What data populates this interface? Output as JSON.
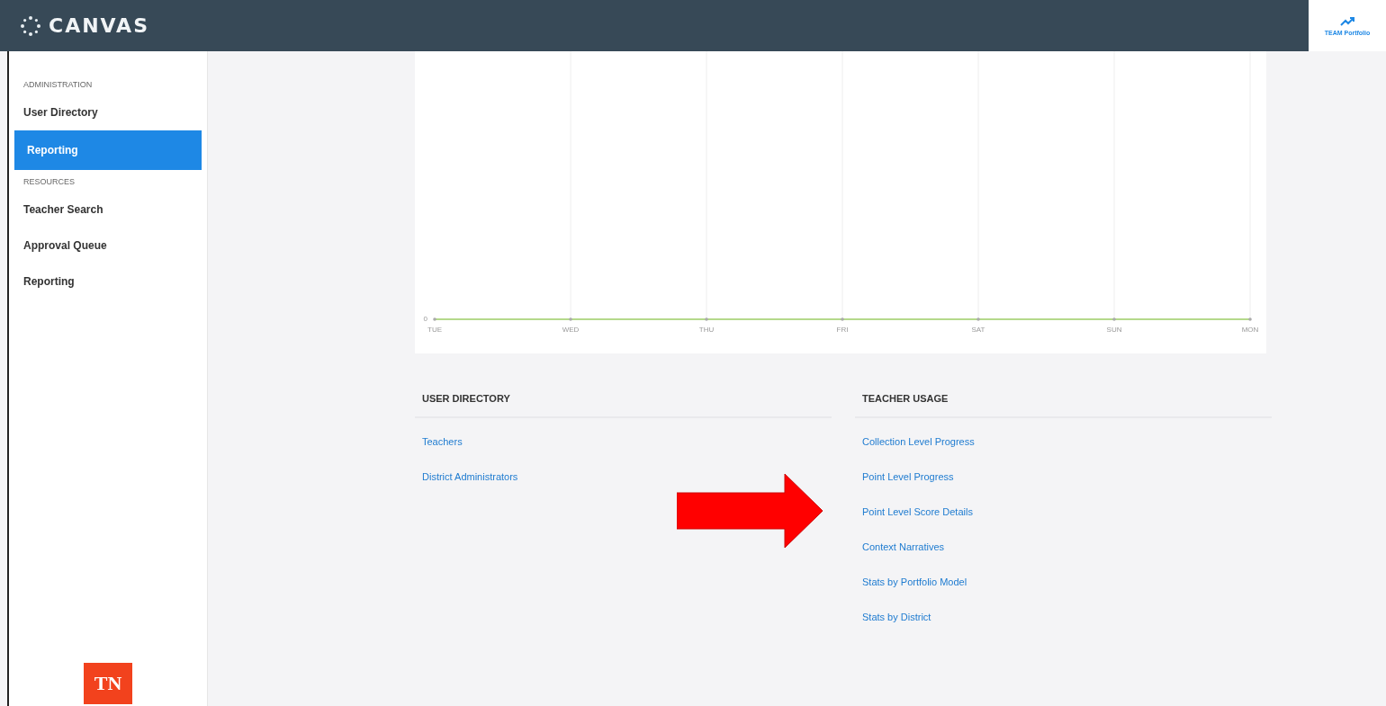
{
  "header": {
    "logo": "CANVAS",
    "portfolio_label": "TEAM Portfolio"
  },
  "sidebar": {
    "sections": [
      {
        "title": "ADMINISTRATION",
        "items": [
          {
            "label": "User Directory",
            "selected": false
          },
          {
            "label": "Reporting",
            "selected": true
          }
        ]
      },
      {
        "title": "RESOURCES",
        "items": [
          {
            "label": "Teacher Search",
            "selected": false
          },
          {
            "label": "Approval Queue",
            "selected": false
          },
          {
            "label": "Reporting",
            "selected": false
          }
        ]
      }
    ],
    "badge": "TN"
  },
  "chart": {
    "y_tick": "0",
    "x_labels": [
      "TUE",
      "WED",
      "THU",
      "FRI",
      "SAT",
      "SUN",
      "MON"
    ]
  },
  "link_groups": [
    {
      "title": "USER DIRECTORY",
      "links": [
        "Teachers",
        "District Administrators"
      ]
    },
    {
      "title": "TEACHER USAGE",
      "links": [
        "Collection Level Progress",
        "Point Level Progress",
        "Point Level Score Details",
        "Context Narratives",
        "Stats by Portfolio Model",
        "Stats by District"
      ]
    }
  ],
  "annotation": {
    "kind": "arrow"
  }
}
